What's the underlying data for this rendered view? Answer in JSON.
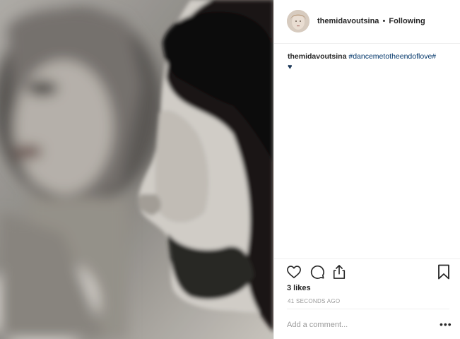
{
  "post": {
    "username": "themidavoutsina",
    "separator": "•",
    "follow_status": "Following",
    "caption": {
      "username": "themidavoutsina",
      "hashtag": "#dancemetotheendoflove#",
      "emoji": "♥"
    },
    "likes": "3 likes",
    "timestamp": "41 SECONDS AGO",
    "comment_placeholder": "Add a comment...",
    "more_options": "•••"
  },
  "icons": {
    "like": "heart-outline-icon",
    "comment": "speech-bubble-icon",
    "share": "share-icon",
    "save": "bookmark-icon"
  },
  "colors": {
    "hashtag": "#003569",
    "muted": "#999999",
    "text": "#262626",
    "divider": "#efefef"
  }
}
